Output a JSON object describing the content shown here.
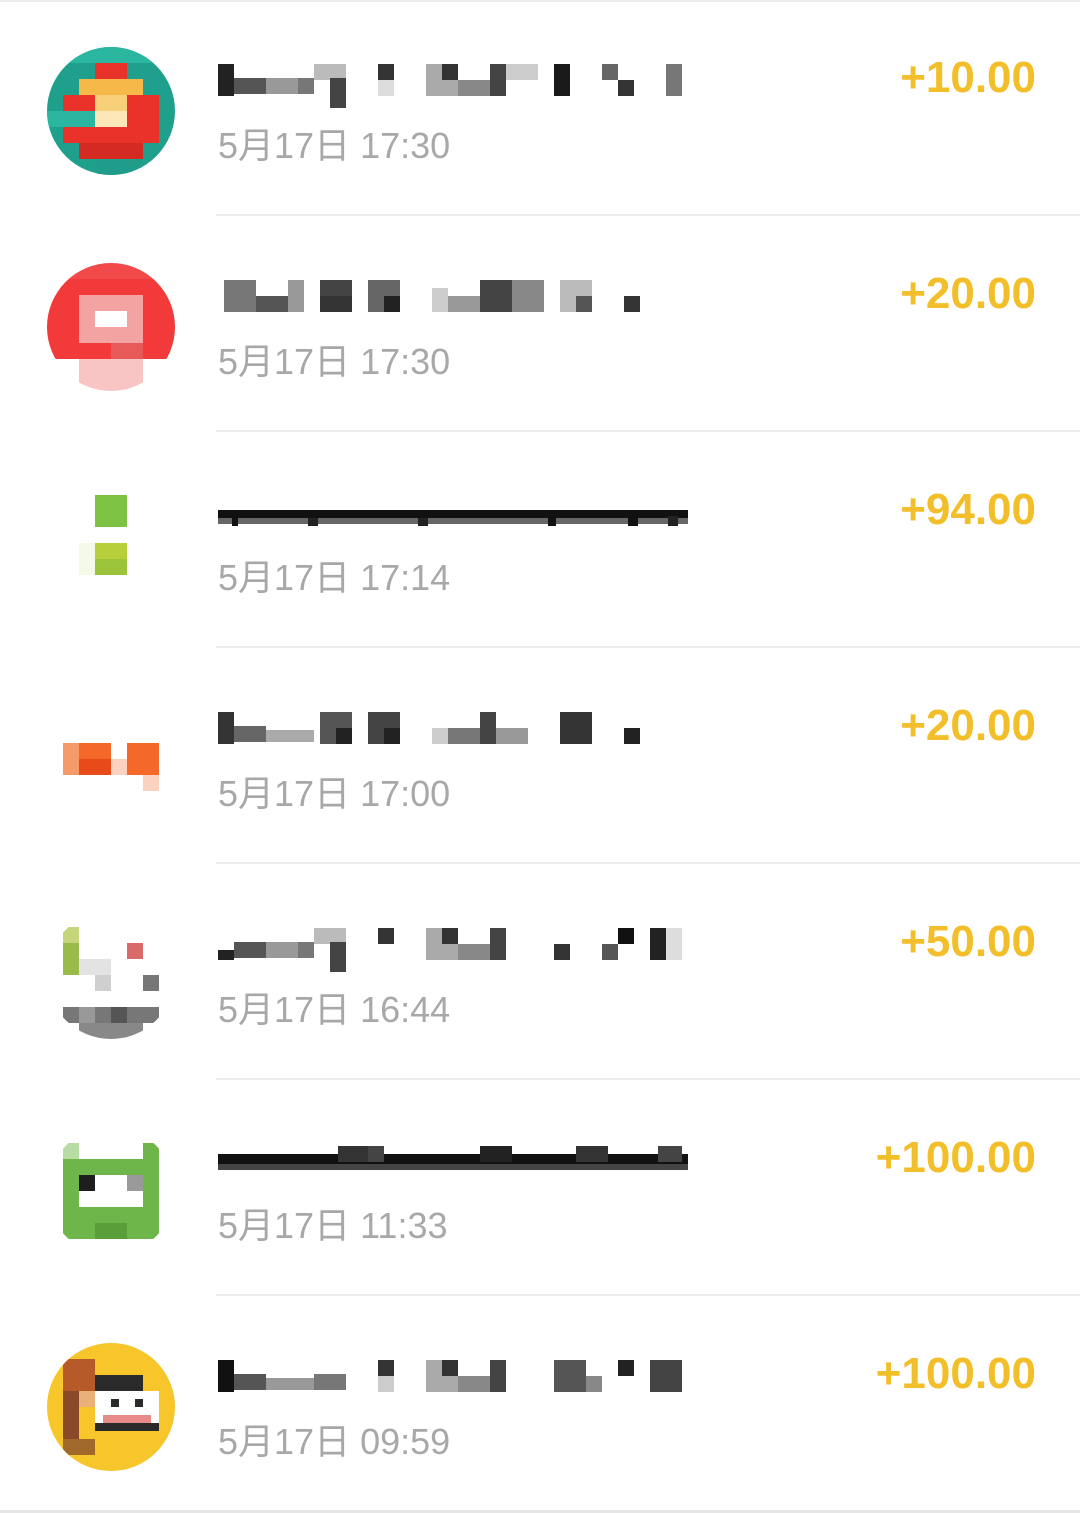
{
  "transactions": [
    {
      "title": "",
      "time": "5月17日 17:30",
      "amount": "+10.00",
      "avatar_colors": [
        "#2bb6a0",
        "#e8322a",
        "#f7b84a",
        "#1f9c8a"
      ]
    },
    {
      "title": "",
      "time": "5月17日 17:30",
      "amount": "+20.00",
      "avatar_colors": [
        "#f23a3a",
        "#f4a3a3",
        "#ffffff",
        "#e85a5a"
      ]
    },
    {
      "title": "",
      "time": "5月17日 17:14",
      "amount": "+94.00",
      "avatar_colors": [
        "#7dc242",
        "#9bc43a",
        "#ffffff",
        "#b6cf3a"
      ]
    },
    {
      "title": "",
      "time": "5月17日 17:00",
      "amount": "+20.00",
      "avatar_colors": [
        "#f4682a",
        "#f79a6a",
        "#fbd1c0",
        "#e84a1a"
      ]
    },
    {
      "title": "",
      "time": "5月17日 16:44",
      "amount": "+50.00",
      "avatar_colors": [
        "#9aba4a",
        "#777777",
        "#e3e3e3",
        "#d96a6a"
      ]
    },
    {
      "title": "",
      "time": "5月17日 11:33",
      "amount": "+100.00",
      "avatar_colors": [
        "#6fb64a",
        "#1e1e1e",
        "#ffffff",
        "#5a9e3a"
      ]
    },
    {
      "title": "",
      "time": "5月17日 09:59",
      "amount": "+100.00",
      "avatar_colors": [
        "#f6c62a",
        "#8a4a2a",
        "#ffffff",
        "#2a2a2a"
      ]
    }
  ],
  "theme": {
    "amount_color": "#f2bf2a",
    "time_color": "#a8a8a8",
    "divider_color": "#ededed"
  }
}
